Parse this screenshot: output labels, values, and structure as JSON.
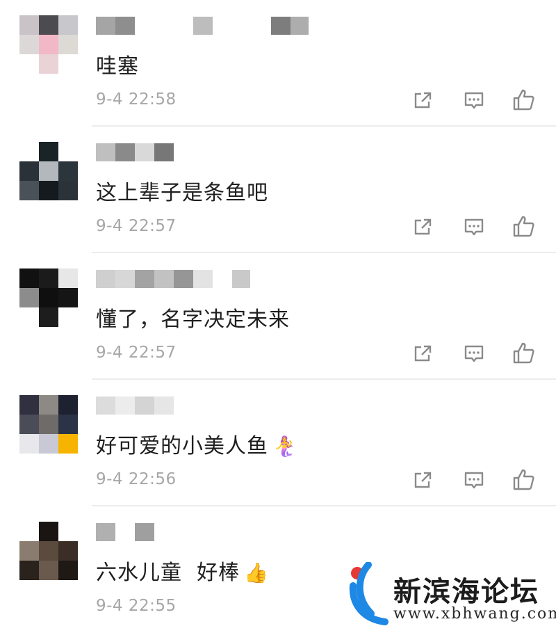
{
  "comments": [
    {
      "text": "哇塞",
      "time": "9-4 22:58",
      "emoji": ""
    },
    {
      "text": "这上辈子是条鱼吧",
      "time": "9-4 22:57",
      "emoji": ""
    },
    {
      "text": "懂了，名字决定未来",
      "time": "9-4 22:57",
      "emoji": ""
    },
    {
      "text": "好可爱的小美人鱼",
      "time": "9-4 22:56",
      "emoji": "🧜‍♀️"
    },
    {
      "text": "六水儿童  好棒",
      "time": "9-4 22:55",
      "emoji": "👍"
    }
  ],
  "action_icons": [
    "share-icon",
    "reply-icon",
    "like-icon"
  ],
  "watermark": {
    "title": "新滨海论坛",
    "url": "www.xbhwang.com"
  },
  "colors": {
    "text": "#1f1f1f",
    "meta": "#a6a6a6",
    "icon": "#8a8a8a",
    "watermark_blue": "#1e88e5",
    "watermark_red": "#e53935"
  }
}
